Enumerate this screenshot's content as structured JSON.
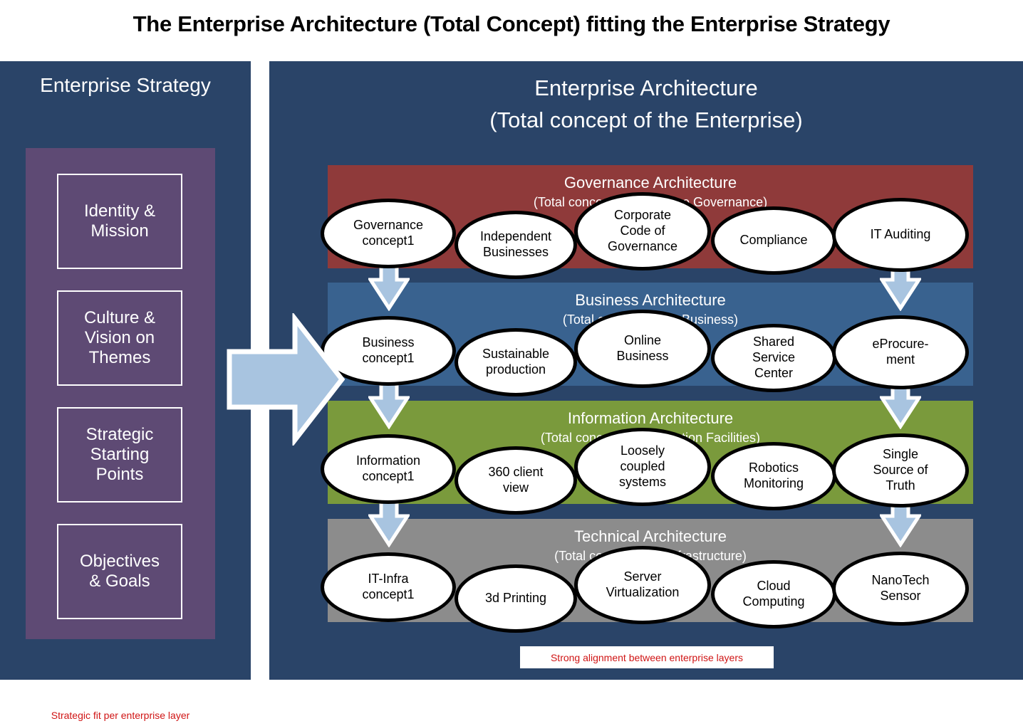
{
  "title": "The Enterprise Architecture (Total Concept) fitting the Enterprise Strategy",
  "strategy": {
    "panel_title": "Enterprise  Strategy",
    "items": [
      {
        "label": "Identity &\nMission"
      },
      {
        "label": "Culture &\nVision on\nThemes"
      },
      {
        "label": "Strategic\nStarting\nPoints"
      },
      {
        "label": "Objectives\n& Goals"
      }
    ],
    "caption": "Strategic fit per enterprise layer",
    "caption_color": "#D01515",
    "panel_color": "#2A4468",
    "inner_color": "#5E4A74"
  },
  "enterprise_architecture": {
    "title_line1": "Enterprise Architecture",
    "title_line2": "(Total concept of the Enterprise)",
    "caption": "Strong alignment  between  enterprise layers",
    "caption_color": "#D01515",
    "panel_color": "#2A4468",
    "layers": [
      {
        "name": "Governance Architecture",
        "subtitle": "(Total concept of Enterprise Governance)",
        "color": "#8F3A3A",
        "concepts": [
          "Governance\nconcept1",
          "Independent\nBusinesses",
          "Corporate\nCode of\nGovernance",
          "Compliance",
          "IT Auditing"
        ]
      },
      {
        "name": "Business Architecture",
        "subtitle": "(Total concept of the Business)",
        "color": "#39628F",
        "concepts": [
          "Business\nconcept1",
          "Sustainable\nproduction",
          "Online\nBusiness",
          "Shared\nService\nCenter",
          "eProcure-\nment"
        ]
      },
      {
        "name": "Information Architecture",
        "subtitle": "(Total concept of Information Facilities)",
        "color": "#7A9A3C",
        "concepts": [
          "Information\nconcept1",
          "360 client\nview",
          "Loosely\ncoupled\nsystems",
          "Robotics\nMonitoring",
          "Single\nSource of\nTruth"
        ]
      },
      {
        "name": "Technical Architecture",
        "subtitle": "(Total concept of IT Infrastructure)",
        "color": "#8C8C8C",
        "concepts": [
          "IT-Infra\nconcept1",
          "3d Printing",
          "Server\nVirtualization",
          "Cloud\nComputing",
          "NanoTech\nSensor"
        ]
      }
    ]
  },
  "arrows": {
    "fill": "#A8C4E0",
    "stroke": "#FFFFFF",
    "alignment_arrow_name": "strategy-to-architecture-arrow",
    "layer_arrow_name": "layer-down-arrow"
  }
}
